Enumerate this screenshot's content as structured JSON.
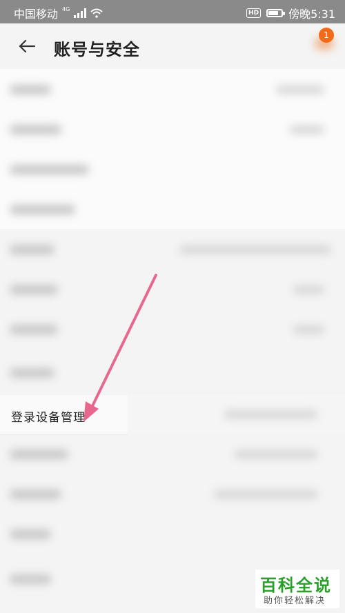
{
  "status_bar": {
    "carrier": "中国移动",
    "network": "4G",
    "time": "傍晚5:31",
    "hd_label": "HD",
    "battery_level": 0.8
  },
  "header": {
    "title": "账号与安全",
    "back_icon": "back-arrow-icon",
    "notification_count": "1"
  },
  "focused_item": {
    "label": "登录设备管理"
  },
  "watermark": {
    "main": "百科全说",
    "sub": "助你轻松解决"
  },
  "colors": {
    "accent_badge": "#f26b1d",
    "annotation_arrow": "#e8678e",
    "watermark_green": "#2aa02a"
  }
}
